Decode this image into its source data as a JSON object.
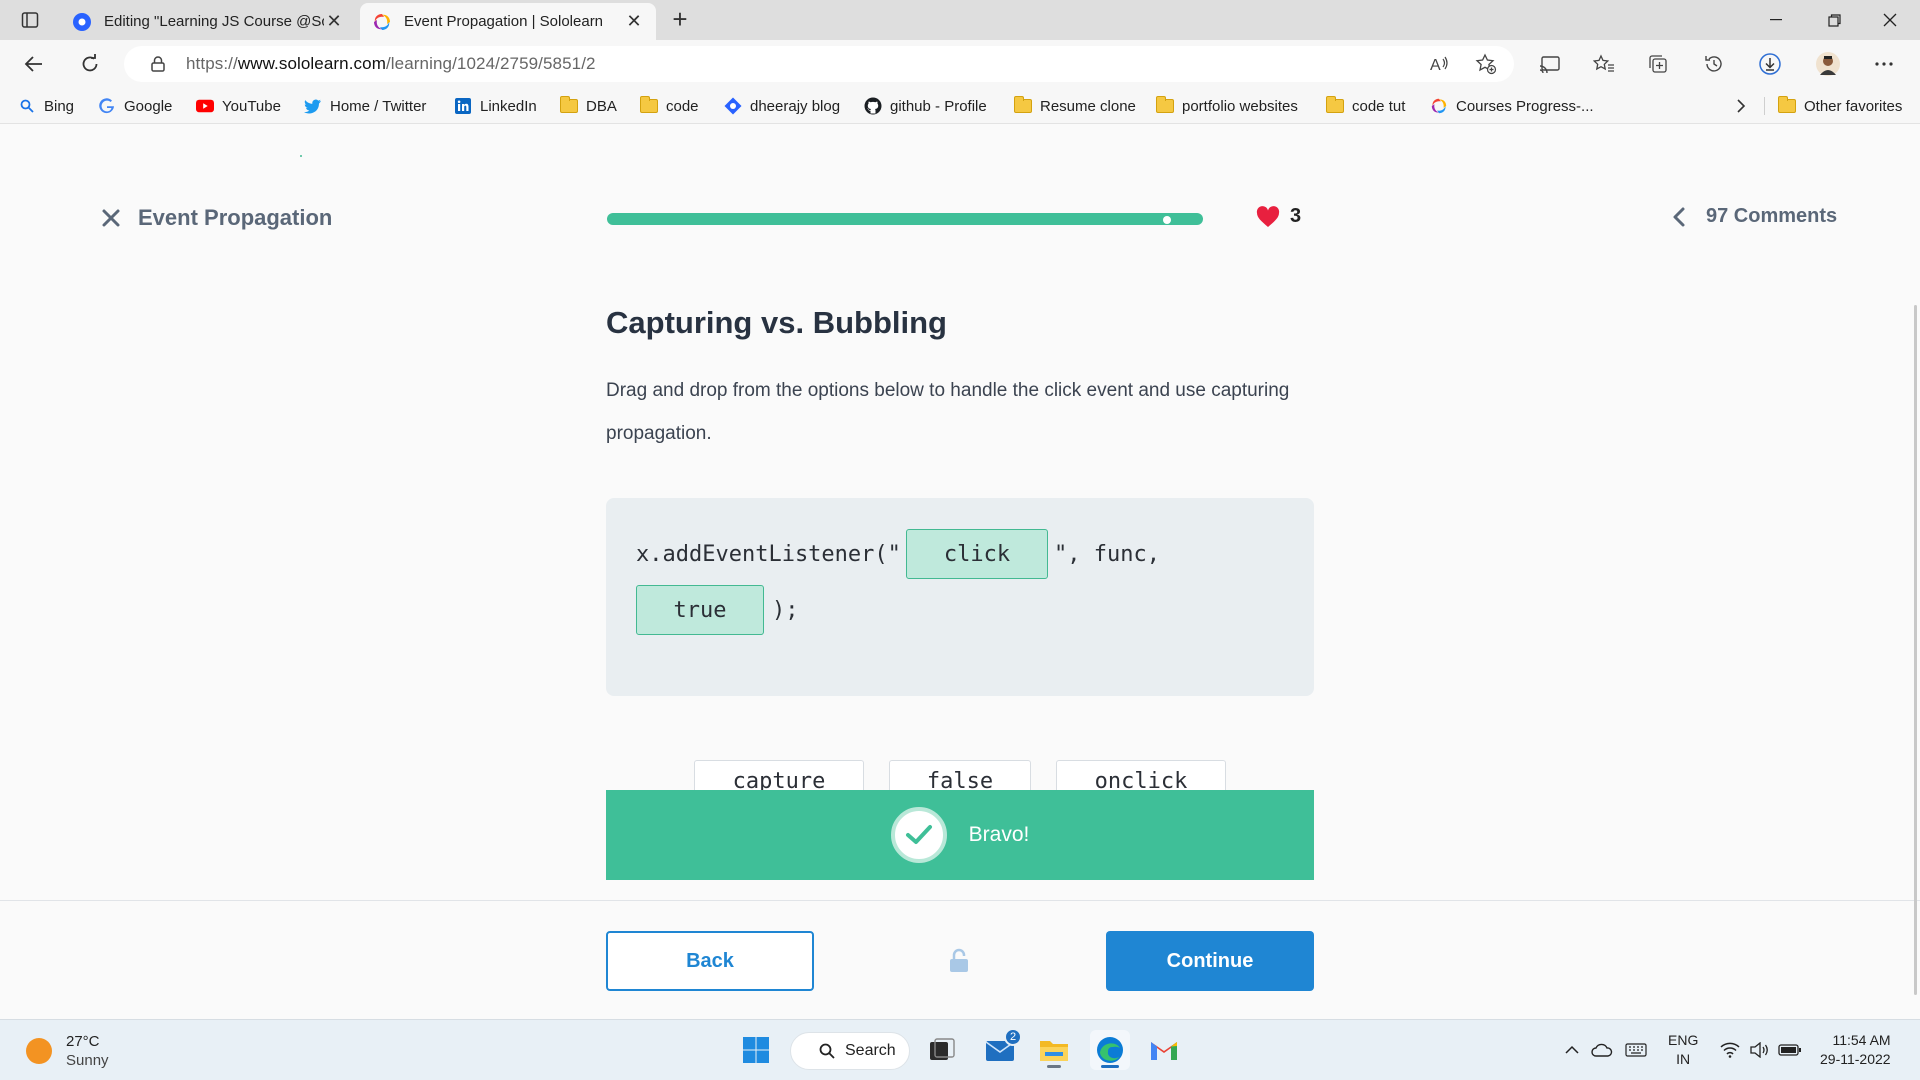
{
  "browser": {
    "tabs": [
      {
        "title": "Editing \"Learning JS Course @Sc",
        "active": false
      },
      {
        "title": "Event Propagation | Sololearn",
        "active": true
      }
    ],
    "url_prefix": "https://",
    "url_host": "www.sololearn.com",
    "url_path": "/learning/1024/2759/5851/2",
    "favorites": [
      {
        "label": "Bing",
        "icon": "bing-search-icon"
      },
      {
        "label": "Google",
        "icon": "google-icon"
      },
      {
        "label": "YouTube",
        "icon": "youtube-icon"
      },
      {
        "label": "Home / Twitter",
        "icon": "twitter-icon"
      },
      {
        "label": "LinkedIn",
        "icon": "linkedin-icon"
      },
      {
        "label": "DBA",
        "icon": "folder-icon"
      },
      {
        "label": "code",
        "icon": "folder-icon"
      },
      {
        "label": "dheerajy blog",
        "icon": "blog-icon"
      },
      {
        "label": "github - Profile",
        "icon": "github-icon"
      },
      {
        "label": "Resume clone",
        "icon": "folder-icon"
      },
      {
        "label": "portfolio websites",
        "icon": "folder-icon"
      },
      {
        "label": "code tut",
        "icon": "folder-icon"
      },
      {
        "label": "Courses Progress-...",
        "icon": "sololearn-icon"
      }
    ],
    "other_favorites": "Other favorites"
  },
  "lesson": {
    "title": "Event Propagation",
    "progress_fraction": 0.94,
    "hearts": "3",
    "comments": "97 Comments"
  },
  "question": {
    "title": "Capturing vs. Bubbling",
    "text": "Drag and drop from the options below to handle the click event and use capturing propagation.",
    "code_part1": "x.addEventListener(\"",
    "slot1": "click",
    "code_part2": "\", func,",
    "slot2": "true",
    "code_part3": ");",
    "options": [
      "capture",
      "false",
      "onclick"
    ]
  },
  "feedback": {
    "message": "Bravo!"
  },
  "buttons": {
    "back": "Back",
    "continue": "Continue"
  },
  "taskbar": {
    "temperature": "27°C",
    "weather": "Sunny",
    "search": "Search",
    "mail_badge": "2",
    "lang_top": "ENG",
    "lang_bottom": "IN",
    "time": "11:54 AM",
    "date": "29-11-2022"
  },
  "colors": {
    "accent_green": "#3fbf98",
    "slot_fill": "#bfe9dc",
    "primary_blue": "#1f86d3",
    "heart_red": "#e8203f"
  }
}
